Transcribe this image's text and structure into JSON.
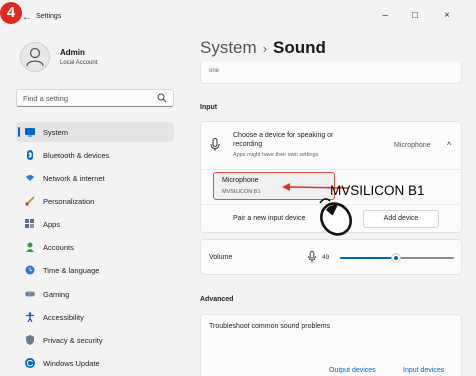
{
  "window": {
    "app_title": "Settings",
    "step_number": "4",
    "minimize": "–",
    "maximize": "□",
    "close": "×"
  },
  "profile": {
    "name": "Admin",
    "account_type": "Local Account"
  },
  "search": {
    "placeholder": "Find a setting"
  },
  "sidebar": {
    "items": [
      {
        "label": "System",
        "icon": "monitor-icon",
        "color": "#0067c0"
      },
      {
        "label": "Bluetooth & devices",
        "icon": "bluetooth-icon",
        "color": "#0067c0"
      },
      {
        "label": "Network & internet",
        "icon": "network-icon",
        "color": "#2b7bd6"
      },
      {
        "label": "Personalization",
        "icon": "brush-icon",
        "color": "#d4821e"
      },
      {
        "label": "Apps",
        "icon": "apps-icon",
        "color": "#5a6b85"
      },
      {
        "label": "Accounts",
        "icon": "person-icon",
        "color": "#2ea043"
      },
      {
        "label": "Time & language",
        "icon": "globe-clock-icon",
        "color": "#2b7bd6"
      },
      {
        "label": "Gaming",
        "icon": "gamepad-icon",
        "color": "#7a8aa0"
      },
      {
        "label": "Accessibility",
        "icon": "accessibility-icon",
        "color": "#1f4fa8"
      },
      {
        "label": "Privacy & security",
        "icon": "shield-icon",
        "color": "#6b7a90"
      },
      {
        "label": "Windows Update",
        "icon": "update-icon",
        "color": "#0067c0"
      }
    ]
  },
  "header": {
    "breadcrumb_parent": "System",
    "separator": "›",
    "current": "Sound"
  },
  "partial_card_text": "one",
  "input_section": {
    "label": "Input",
    "choose_title": "Choose a device for speaking or recording",
    "choose_sub": "Apps might have their own settings",
    "choose_value": "Microphone",
    "device_title": "Microphone",
    "device_sub": "MVSILICON B1",
    "pair_label": "Pair a new input device",
    "add_button": "Add device"
  },
  "volume": {
    "label": "Volume",
    "value": "49",
    "level": 0.49
  },
  "advanced": {
    "label": "Advanced",
    "troubleshoot": "Troubleshoot common sound problems",
    "output_link": "Output devices",
    "input_link": "Input devices"
  },
  "annotation": {
    "text": "MVSILICON B1",
    "color": "#e0302a"
  }
}
